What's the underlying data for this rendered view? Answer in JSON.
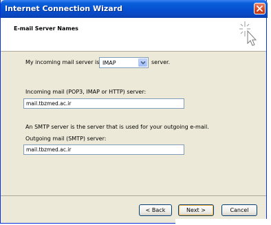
{
  "window": {
    "title": "Internet Connection Wizard"
  },
  "header": {
    "title": "E-mail Server Names"
  },
  "content": {
    "incoming_prefix": "My incoming mail server is a",
    "server_type": "IMAP",
    "incoming_suffix": "server.",
    "incoming_label": "Incoming mail (POP3, IMAP or HTTP) server:",
    "incoming_value": "mail.tbzmed.ac.ir",
    "smtp_note": "An SMTP server is the server that is used for your outgoing e-mail.",
    "outgoing_label": "Outgoing mail (SMTP) server:",
    "outgoing_value": "mail.tbzmed.ac.ir"
  },
  "buttons": {
    "back": "< Back",
    "next": "Next >",
    "cancel": "Cancel"
  },
  "colors": {
    "titlebar": "#0550d0",
    "dialog_bg": "#ece9d8",
    "close": "#d4461f"
  }
}
